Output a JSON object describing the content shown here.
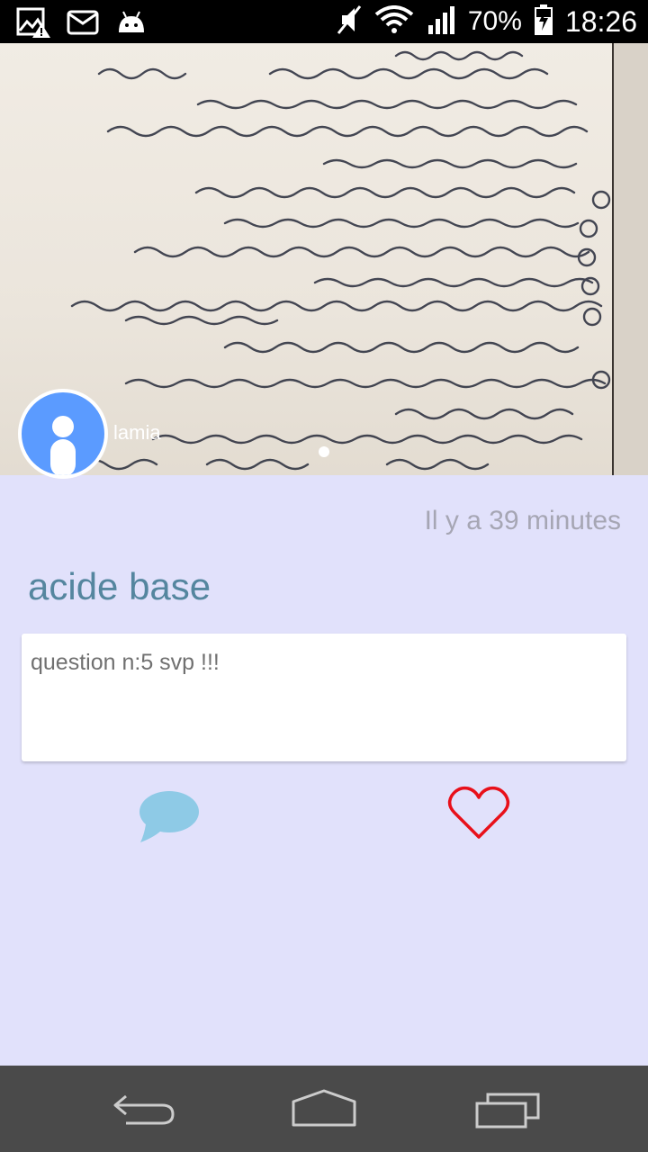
{
  "status_bar": {
    "battery_percent": "70%",
    "time": "18:26",
    "icons": [
      "image-warning-icon",
      "email-icon",
      "android-icon",
      "mute-icon",
      "wifi-icon",
      "signal-icon",
      "battery-charging-icon"
    ]
  },
  "post": {
    "author": "lamia",
    "timestamp": "Il y a 39 minutes",
    "title": "acide base",
    "body": "question n:5 svp !!!",
    "image_page_indicator": 1
  },
  "actions": {
    "comment_icon": "speech-bubble-icon",
    "like_icon": "heart-icon",
    "comment_color": "#8ecae6",
    "like_color": "#e8101a"
  },
  "nav_bar": {
    "icons": [
      "back-icon",
      "home-icon",
      "recents-icon"
    ]
  },
  "colors": {
    "background": "#e1e1fb",
    "title": "#55869f",
    "avatar": "#5b9bff"
  }
}
